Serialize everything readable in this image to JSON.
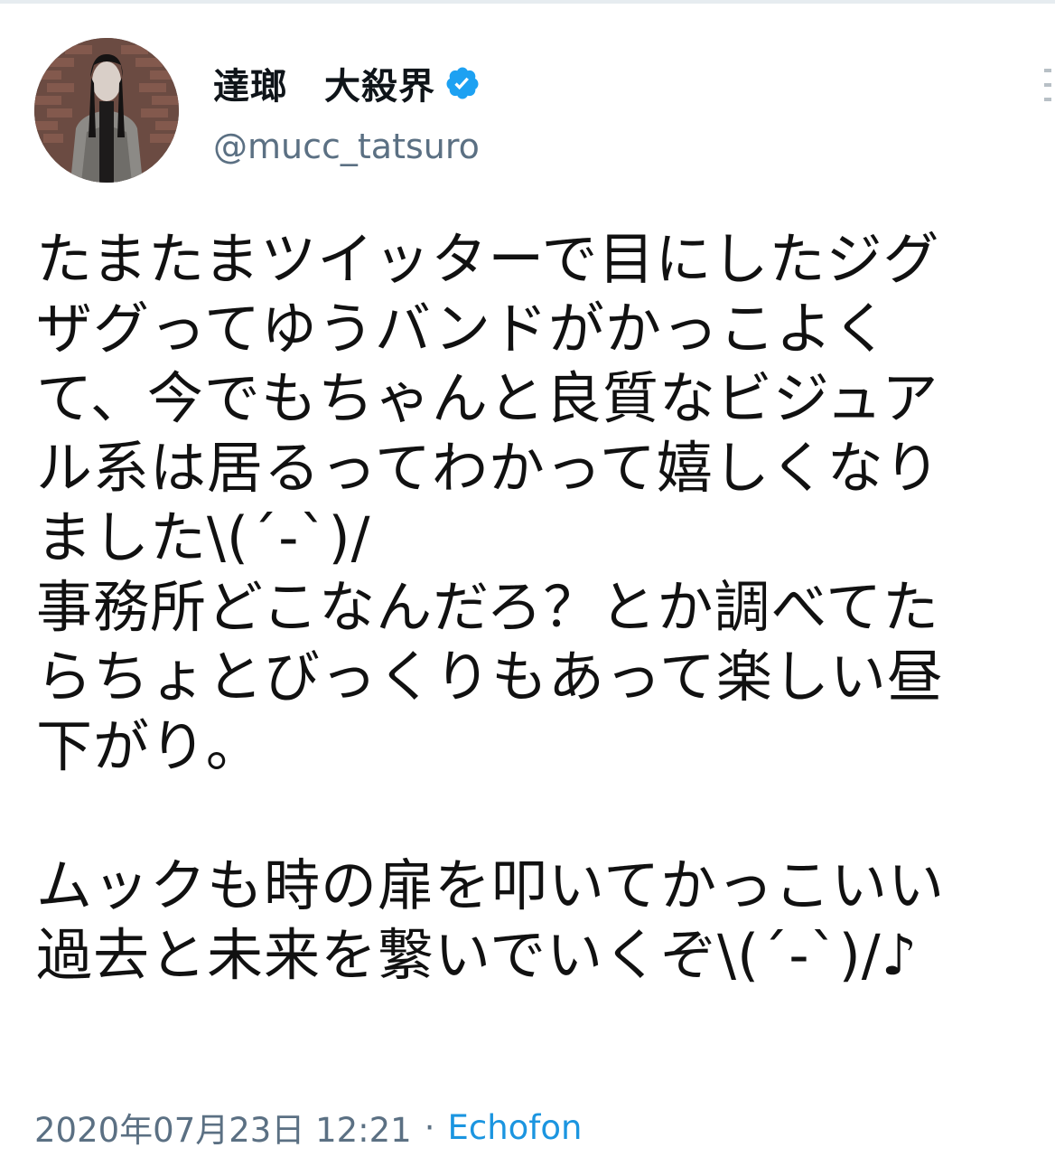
{
  "tweet": {
    "display_name": "達瑯　大殺界",
    "handle": "@mucc_tatsuro",
    "verified": true,
    "text": "たまたまツイッターで目にしたジグ\nザグってゆうバンドがかっこよく\nて、今でもちゃんと良質なビジュア\nル系は居るってわかって嬉しくなり\nました\\(´-`)/\n事務所どこなんだろ？とか調べてた\nらちょとびっくりもあって楽しい昼\n下がり。\n\nムックも時の扉を叩いてかっこいい\n過去と未来を繋いでいくぞ\\(´-`)/♪",
    "timestamp": "2020年07月23日 12:21",
    "separator": "·",
    "source": "Echofon"
  },
  "colors": {
    "verified_badge": "#1da1f2",
    "secondary_text": "#5b7083",
    "link": "#1b95e0"
  },
  "icons": {
    "verified": "verified-badge-icon",
    "more": "more-options-icon"
  }
}
